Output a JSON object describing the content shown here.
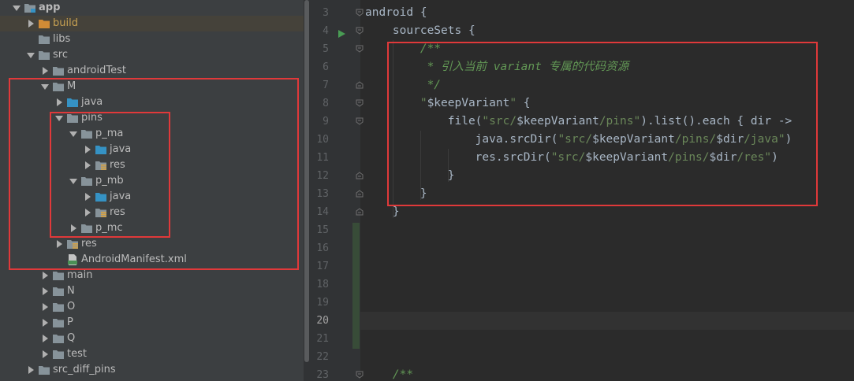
{
  "project_tree": {
    "items": [
      {
        "label": "app",
        "icon": "module-folder-icon",
        "expanded": true,
        "bold": true
      },
      {
        "label": "build",
        "icon": "excluded-folder-icon",
        "expanded": false,
        "highlight": true
      },
      {
        "label": "libs",
        "icon": "folder-icon",
        "leaf": true
      },
      {
        "label": "src",
        "icon": "folder-icon",
        "expanded": true
      },
      {
        "label": "androidTest",
        "icon": "folder-icon",
        "expanded": false
      },
      {
        "label": "M",
        "icon": "folder-icon",
        "expanded": true
      },
      {
        "label": "java",
        "icon": "source-folder-icon",
        "expanded": false
      },
      {
        "label": "pins",
        "icon": "folder-icon",
        "expanded": true
      },
      {
        "label": "p_ma",
        "icon": "folder-icon",
        "expanded": true
      },
      {
        "label": "java",
        "icon": "source-folder-icon",
        "expanded": false
      },
      {
        "label": "res",
        "icon": "resources-folder-icon",
        "expanded": false
      },
      {
        "label": "p_mb",
        "icon": "folder-icon",
        "expanded": true
      },
      {
        "label": "java",
        "icon": "source-folder-icon",
        "expanded": false
      },
      {
        "label": "res",
        "icon": "resources-folder-icon",
        "expanded": false
      },
      {
        "label": "p_mc",
        "icon": "folder-icon",
        "expanded": false
      },
      {
        "label": "res",
        "icon": "resources-folder-icon",
        "expanded": false
      },
      {
        "label": "AndroidManifest.xml",
        "icon": "xml-file-icon",
        "leaf": true
      },
      {
        "label": "main",
        "icon": "folder-icon",
        "expanded": false
      },
      {
        "label": "N",
        "icon": "folder-icon",
        "expanded": false
      },
      {
        "label": "O",
        "icon": "folder-icon",
        "expanded": false
      },
      {
        "label": "P",
        "icon": "folder-icon",
        "expanded": false
      },
      {
        "label": "Q",
        "icon": "folder-icon",
        "expanded": false
      },
      {
        "label": "test",
        "icon": "folder-icon",
        "expanded": false
      },
      {
        "label": "src_diff_pins",
        "icon": "folder-icon",
        "expanded": false
      }
    ]
  },
  "editor": {
    "current_line": 20,
    "lines": [
      {
        "num": 3,
        "fold": "open",
        "tokens": [
          {
            "t": "android {",
            "k": "plain"
          }
        ]
      },
      {
        "num": 4,
        "fold": "open",
        "run": true,
        "tokens": [
          {
            "t": "    sourceSets {",
            "k": "plain"
          }
        ]
      },
      {
        "num": 5,
        "fold": "open",
        "tokens": [
          {
            "t": "        /**",
            "k": "cmt"
          }
        ]
      },
      {
        "num": 6,
        "tokens": [
          {
            "t": "         * 引入当前 variant 专属的代码资源",
            "k": "cmt"
          }
        ]
      },
      {
        "num": 7,
        "fold": "close",
        "tokens": [
          {
            "t": "         */",
            "k": "cmt"
          }
        ]
      },
      {
        "num": 8,
        "fold": "open",
        "tokens": [
          {
            "t": "        ",
            "k": "plain"
          },
          {
            "t": "\"",
            "k": "str"
          },
          {
            "t": "$keepVariant",
            "k": "plain"
          },
          {
            "t": "\"",
            "k": "str"
          },
          {
            "t": " {",
            "k": "plain"
          }
        ]
      },
      {
        "num": 9,
        "fold": "open",
        "tokens": [
          {
            "t": "            file(",
            "k": "plain"
          },
          {
            "t": "\"src/",
            "k": "str"
          },
          {
            "t": "$keepVariant",
            "k": "plain"
          },
          {
            "t": "/pins\"",
            "k": "str"
          },
          {
            "t": ").list().each { dir ->",
            "k": "plain"
          }
        ]
      },
      {
        "num": 10,
        "tokens": [
          {
            "t": "                java.srcDir(",
            "k": "plain"
          },
          {
            "t": "\"src/",
            "k": "str"
          },
          {
            "t": "$keepVariant",
            "k": "plain"
          },
          {
            "t": "/pins/",
            "k": "str"
          },
          {
            "t": "$dir",
            "k": "plain"
          },
          {
            "t": "/java\"",
            "k": "str"
          },
          {
            "t": ")",
            "k": "plain"
          }
        ]
      },
      {
        "num": 11,
        "tokens": [
          {
            "t": "                res.srcDir(",
            "k": "plain"
          },
          {
            "t": "\"src/",
            "k": "str"
          },
          {
            "t": "$keepVariant",
            "k": "plain"
          },
          {
            "t": "/pins/",
            "k": "str"
          },
          {
            "t": "$dir",
            "k": "plain"
          },
          {
            "t": "/res\"",
            "k": "str"
          },
          {
            "t": ")",
            "k": "plain"
          }
        ]
      },
      {
        "num": 12,
        "fold": "close",
        "tokens": [
          {
            "t": "            }",
            "k": "plain"
          }
        ]
      },
      {
        "num": 13,
        "fold": "close",
        "tokens": [
          {
            "t": "        }",
            "k": "plain"
          }
        ]
      },
      {
        "num": 14,
        "fold": "close",
        "tokens": [
          {
            "t": "    }",
            "k": "plain"
          }
        ]
      },
      {
        "num": 15,
        "tokens": []
      },
      {
        "num": 16,
        "tokens": []
      },
      {
        "num": 17,
        "tokens": []
      },
      {
        "num": 18,
        "tokens": []
      },
      {
        "num": 19,
        "tokens": []
      },
      {
        "num": 20,
        "tokens": []
      },
      {
        "num": 21,
        "tokens": []
      },
      {
        "num": 22,
        "tokens": []
      },
      {
        "num": 23,
        "fold": "open",
        "tokens": [
          {
            "t": "    /**",
            "k": "cmt"
          }
        ]
      }
    ]
  },
  "colors": {
    "annotation": "#e0393a",
    "string": "#6a8759",
    "comment": "#629755",
    "plain": "#a9b7c6",
    "tree_background": "#3c3f41",
    "editor_background": "#2b2b2b"
  }
}
